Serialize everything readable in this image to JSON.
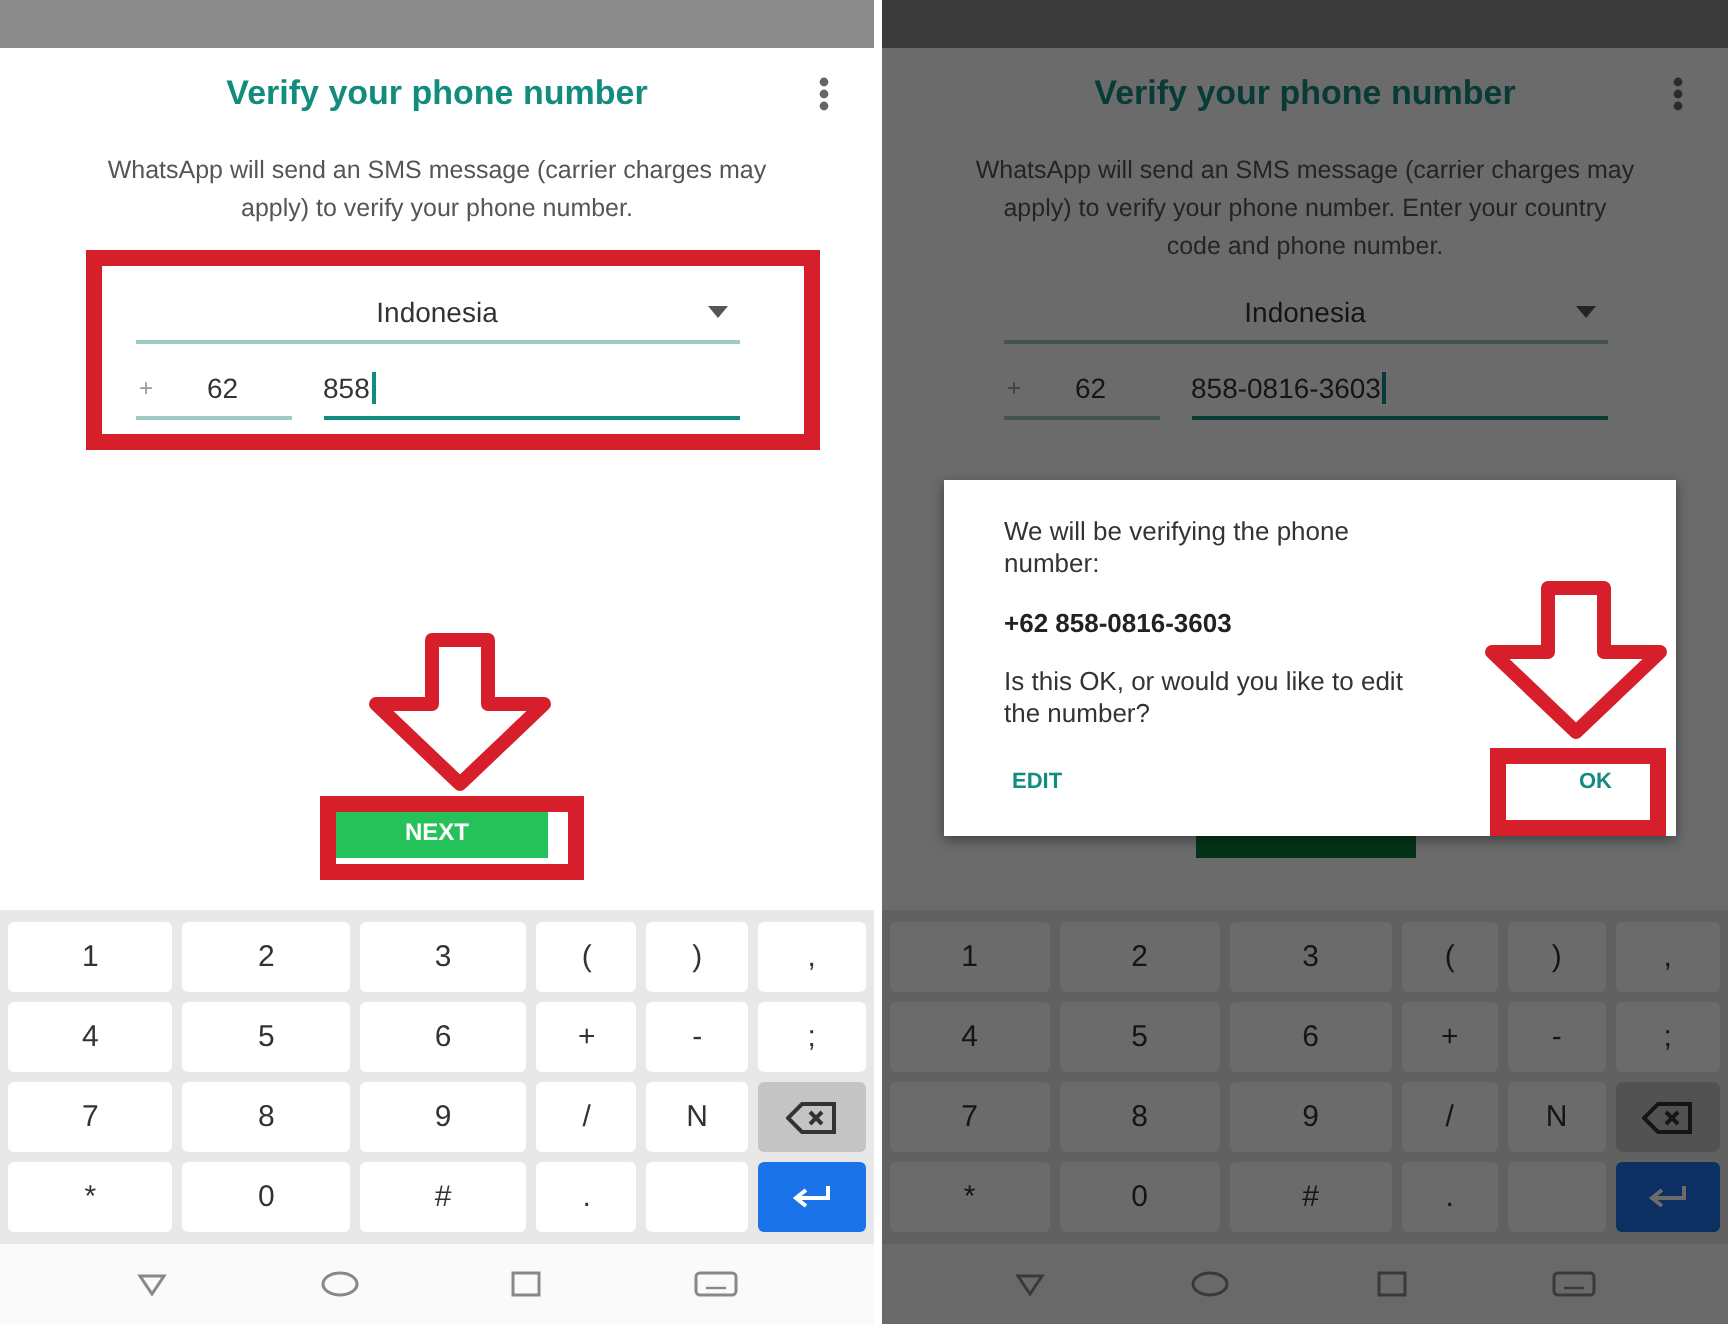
{
  "panels": [
    {
      "dimmed": false,
      "title": "Verify your phone number",
      "description": "WhatsApp will send an SMS message (carrier charges may apply) to verify your phone number.",
      "country": "Indonesia",
      "code_prefix": "+",
      "country_code": "62",
      "phone": "858",
      "next_button": {
        "label": "NEXT",
        "covered": false
      },
      "keyboard": [
        [
          {
            "kind": "char",
            "label": "1"
          },
          {
            "kind": "char",
            "label": "2"
          },
          {
            "kind": "char",
            "label": "3"
          },
          {
            "kind": "char",
            "label": "("
          },
          {
            "kind": "char",
            "label": ")"
          },
          {
            "kind": "char",
            "label": ","
          }
        ],
        [
          {
            "kind": "char",
            "label": "4"
          },
          {
            "kind": "char",
            "label": "5"
          },
          {
            "kind": "char",
            "label": "6"
          },
          {
            "kind": "char",
            "label": "+"
          },
          {
            "kind": "char",
            "label": "-"
          },
          {
            "kind": "char",
            "label": ";"
          }
        ],
        [
          {
            "kind": "char",
            "label": "7"
          },
          {
            "kind": "char",
            "label": "8"
          },
          {
            "kind": "char",
            "label": "9"
          },
          {
            "kind": "char",
            "label": "/"
          },
          {
            "kind": "char",
            "label": "N"
          },
          {
            "kind": "backspace"
          }
        ],
        [
          {
            "kind": "char",
            "label": "*"
          },
          {
            "kind": "char",
            "label": "0"
          },
          {
            "kind": "char",
            "label": "#"
          },
          {
            "kind": "char",
            "label": "."
          },
          {
            "kind": "blank"
          },
          {
            "kind": "enter"
          }
        ]
      ],
      "annotations": [
        {
          "kind": "fields-box"
        },
        {
          "kind": "next-arrow"
        },
        {
          "kind": "next-box"
        }
      ]
    },
    {
      "dimmed": true,
      "title": "Verify your phone number",
      "description": "WhatsApp will send an SMS message (carrier charges may apply) to verify your phone number. Enter your country code and phone number.",
      "country": "Indonesia",
      "code_prefix": "+",
      "country_code": "62",
      "phone": "858-0816-3603",
      "next_button": {
        "covered": true
      },
      "keyboard": [
        [
          {
            "kind": "char",
            "label": "1"
          },
          {
            "kind": "char",
            "label": "2"
          },
          {
            "kind": "char",
            "label": "3"
          },
          {
            "kind": "char",
            "label": "("
          },
          {
            "kind": "char",
            "label": ")"
          },
          {
            "kind": "char",
            "label": ","
          }
        ],
        [
          {
            "kind": "char",
            "label": "4"
          },
          {
            "kind": "char",
            "label": "5"
          },
          {
            "kind": "char",
            "label": "6"
          },
          {
            "kind": "char",
            "label": "+"
          },
          {
            "kind": "char",
            "label": "-"
          },
          {
            "kind": "char",
            "label": ";"
          }
        ],
        [
          {
            "kind": "char",
            "label": "7"
          },
          {
            "kind": "char",
            "label": "8"
          },
          {
            "kind": "char",
            "label": "9"
          },
          {
            "kind": "char",
            "label": "/"
          },
          {
            "kind": "char",
            "label": "N"
          },
          {
            "kind": "backspace"
          }
        ],
        [
          {
            "kind": "char",
            "label": "*"
          },
          {
            "kind": "char",
            "label": "0"
          },
          {
            "kind": "char",
            "label": "#"
          },
          {
            "kind": "char",
            "label": "."
          },
          {
            "kind": "blank"
          },
          {
            "kind": "enter"
          }
        ]
      ],
      "dialog": {
        "message": "We will be verifying the phone number:",
        "number": "+62 858-0816-3603",
        "question": "Is this OK, or would you like to edit the number?",
        "buttons": [
          "EDIT",
          "OK"
        ]
      },
      "annotations": [
        {
          "kind": "ok-arrow"
        },
        {
          "kind": "ok-box"
        }
      ]
    }
  ]
}
